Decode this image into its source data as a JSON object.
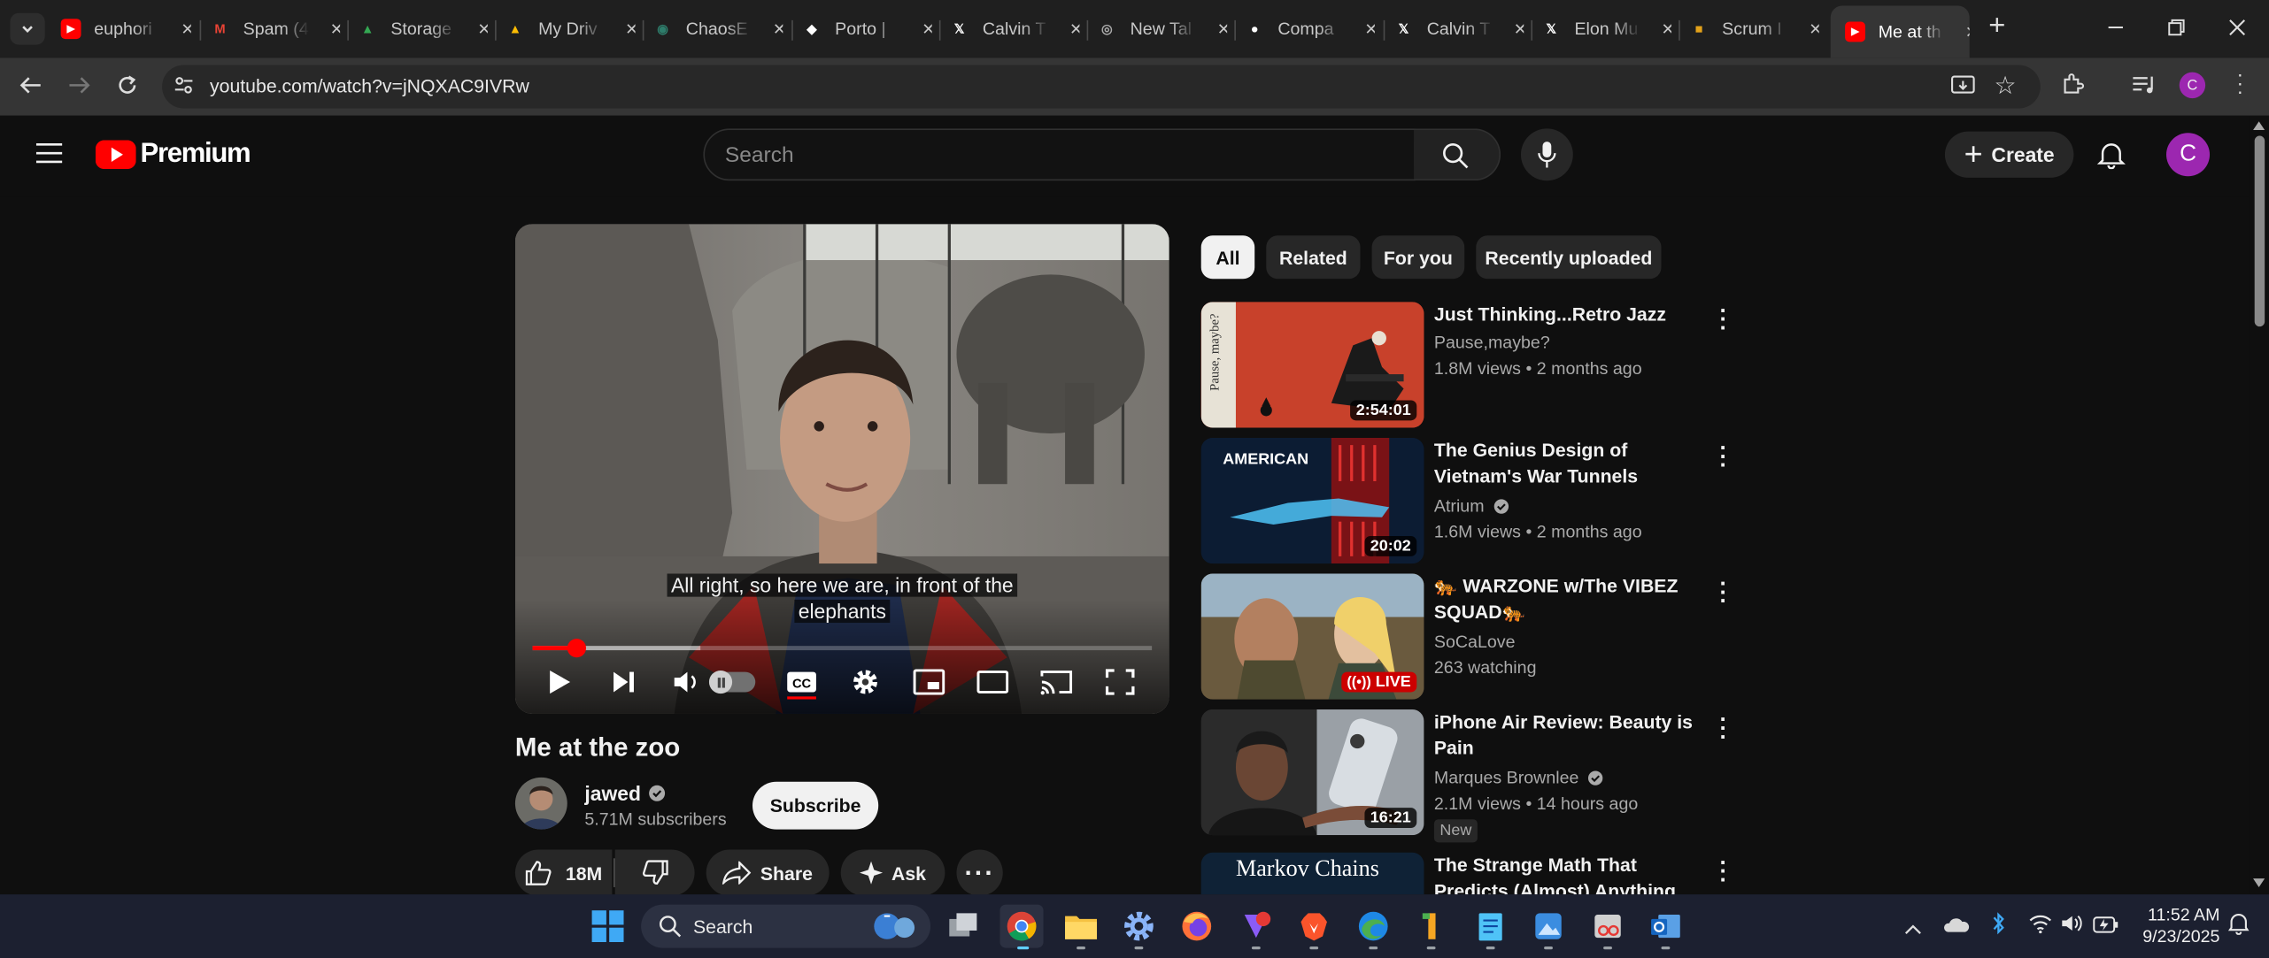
{
  "browser": {
    "tabs": [
      {
        "label": "euphori",
        "favicon": "youtube-icon",
        "color": "#ff0000"
      },
      {
        "label": "Spam (4",
        "favicon": "gmail-icon",
        "color": "#ea4335"
      },
      {
        "label": "Storage",
        "favicon": "google-drive-icon",
        "color": "#34a853"
      },
      {
        "label": "My Driv",
        "favicon": "google-drive-icon",
        "color": "#fbbc04"
      },
      {
        "label": "ChaosE",
        "favicon": "wikimedia-icon",
        "color": "#2e7d6b"
      },
      {
        "label": "Porto |",
        "favicon": "porto-icon",
        "color": "#ffffff"
      },
      {
        "label": "Calvin T",
        "favicon": "x-icon",
        "color": "#ffffff"
      },
      {
        "label": "New Tal",
        "favicon": "chrome-icon",
        "color": "#aaaaaa"
      },
      {
        "label": "Compa",
        "favicon": "github-icon",
        "color": "#ffffff"
      },
      {
        "label": "Calvin T",
        "favicon": "x-icon",
        "color": "#ffffff"
      },
      {
        "label": "Elon Mu",
        "favicon": "x-icon",
        "color": "#ffffff"
      },
      {
        "label": "Scrum I",
        "favicon": "notes-icon",
        "color": "#e3a21a"
      },
      {
        "label": "Me at th",
        "favicon": "youtube-icon",
        "color": "#ff0000",
        "active": true
      }
    ],
    "url": "youtube.com/watch?v=jNQXAC9IVRw"
  },
  "youtube": {
    "logo_text": "Premium",
    "search_placeholder": "Search",
    "create_label": "Create",
    "avatar_letter": "C",
    "avatar_color": "#9c27b0"
  },
  "player": {
    "caption_line1": "All right, so here we are, in front of the",
    "caption_line2": "elephants",
    "progress_fraction": 0.07,
    "buffer_fraction": 0.27,
    "volume_fraction": 0.35
  },
  "video": {
    "title": "Me at the zoo",
    "channel": "jawed",
    "subscribers": "5.71M subscribers",
    "subscribe_label": "Subscribe",
    "likes": "18M",
    "share_label": "Share",
    "ask_label": "Ask"
  },
  "filters": [
    "All",
    "Related",
    "For you",
    "Recently uploaded"
  ],
  "recommendations": [
    {
      "title": "Just Thinking...Retro Jazz",
      "channel": "Pause,maybe?",
      "verified": false,
      "meta": "1.8M views • 2 months ago",
      "duration": "2:54:01",
      "thumb_text": "Pause, maybe?"
    },
    {
      "title": "The Genius Design of Vietnam's War Tunnels",
      "channel": "Atrium",
      "verified": true,
      "meta": "1.6M views • 2 months ago",
      "duration": "20:02",
      "thumb_text": "AMERICAN"
    },
    {
      "title": "🐅 WARZONE w/The VIBEZ SQUAD🐅",
      "channel": "SoCaLove",
      "verified": false,
      "meta": "263 watching",
      "duration": "LIVE",
      "thumb_text": ""
    },
    {
      "title": "iPhone Air Review: Beauty is Pain",
      "channel": "Marques Brownlee",
      "verified": true,
      "meta": "2.1M views • 14 hours ago",
      "duration": "16:21",
      "badge": "New",
      "thumb_text": ""
    },
    {
      "title": "The Strange Math That Predicts (Almost) Anything",
      "channel": "",
      "verified": false,
      "meta": "",
      "duration": "",
      "thumb_text": "Markov Chains"
    }
  ],
  "taskbar": {
    "search_label": "Search",
    "time": "11:52 AM",
    "date": "9/23/2025"
  }
}
